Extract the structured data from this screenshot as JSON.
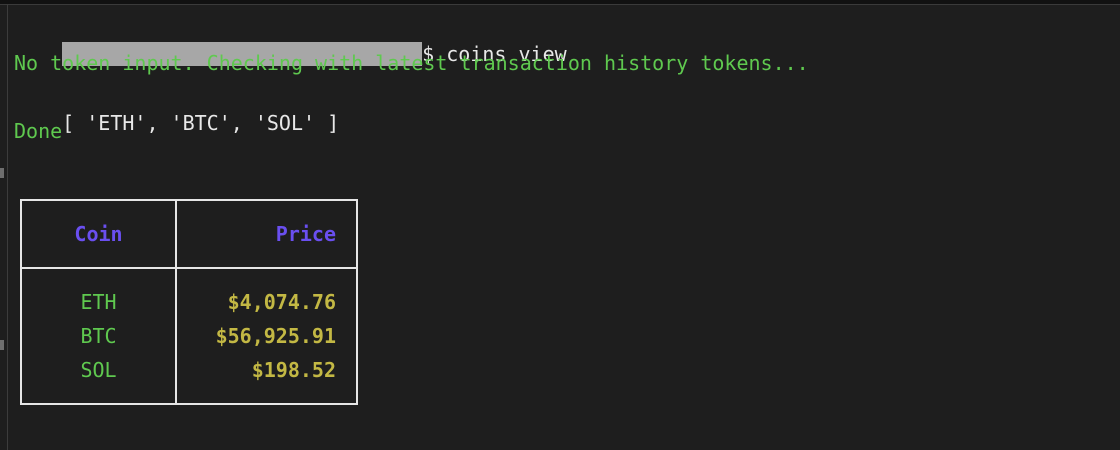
{
  "terminal": {
    "command": "$ coins view",
    "info_message": "No token input. Checking with latest transaction history tokens...",
    "token_array": "[ 'ETH', 'BTC', 'SOL' ]",
    "done_message": "Done"
  },
  "table": {
    "headers": {
      "coin": "Coin",
      "price": "Price"
    },
    "rows": [
      {
        "coin": "ETH",
        "price": "$4,074.76"
      },
      {
        "coin": "BTC",
        "price": "$56,925.91"
      },
      {
        "coin": "SOL",
        "price": "$198.52"
      }
    ]
  },
  "colors": {
    "background": "#1e1e1e",
    "output_green": "#5fc94f",
    "header_purple": "#6a4ff0",
    "price_yellow": "#c3b844",
    "text_white": "#e8e8e8"
  }
}
